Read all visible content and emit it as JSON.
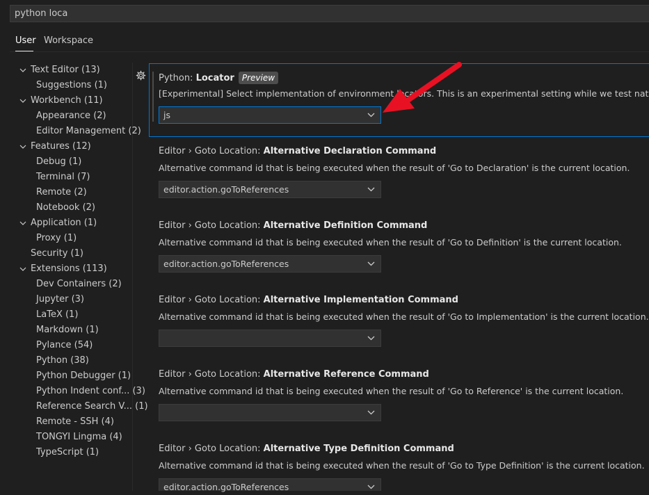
{
  "search": {
    "value": "python loca"
  },
  "tabs": [
    {
      "label": "User"
    },
    {
      "label": "Workspace"
    }
  ],
  "tree": [
    {
      "label": "Text Editor (13)"
    },
    {
      "label": "Suggestions (1)"
    },
    {
      "label": "Workbench (11)"
    },
    {
      "label": "Appearance (2)"
    },
    {
      "label": "Editor Management (2)"
    },
    {
      "label": "Features (12)"
    },
    {
      "label": "Debug (1)"
    },
    {
      "label": "Terminal (7)"
    },
    {
      "label": "Remote (2)"
    },
    {
      "label": "Notebook (2)"
    },
    {
      "label": "Application (1)"
    },
    {
      "label": "Proxy (1)"
    },
    {
      "label": "Security (1)"
    },
    {
      "label": "Extensions (113)"
    },
    {
      "label": "Dev Containers (2)"
    },
    {
      "label": "Jupyter (3)"
    },
    {
      "label": "LaTeX (1)"
    },
    {
      "label": "Markdown (1)"
    },
    {
      "label": "Pylance (54)"
    },
    {
      "label": "Python (38)"
    },
    {
      "label": "Python Debugger (1)"
    },
    {
      "label": "Python Indent conf... (3)"
    },
    {
      "label": "Reference Search V... (1)"
    },
    {
      "label": "Remote - SSH (4)"
    },
    {
      "label": "TONGYI Lingma (4)"
    },
    {
      "label": "TypeScript (1)"
    }
  ],
  "settings": [
    {
      "category": "Python: ",
      "name": "Locator",
      "badge": "Preview",
      "description": "[Experimental] Select implementation of environment locators. This is an experimental setting while we test native environment location.",
      "value": "js"
    },
    {
      "category": "Editor › Goto Location: ",
      "name": "Alternative Declaration Command",
      "description": "Alternative command id that is being executed when the result of 'Go to Declaration' is the current location.",
      "value": "editor.action.goToReferences"
    },
    {
      "category": "Editor › Goto Location: ",
      "name": "Alternative Definition Command",
      "description": "Alternative command id that is being executed when the result of 'Go to Definition' is the current location.",
      "value": "editor.action.goToReferences"
    },
    {
      "category": "Editor › Goto Location: ",
      "name": "Alternative Implementation Command",
      "description": "Alternative command id that is being executed when the result of 'Go to Implementation' is the current location.",
      "value": ""
    },
    {
      "category": "Editor › Goto Location: ",
      "name": "Alternative Reference Command",
      "description": "Alternative command id that is being executed when the result of 'Go to Reference' is the current location.",
      "value": ""
    },
    {
      "category": "Editor › Goto Location: ",
      "name": "Alternative Type Definition Command",
      "description": "Alternative command id that is being executed when the result of 'Go to Type Definition' is the current location.",
      "value": "editor.action.goToReferences"
    }
  ],
  "colors": {
    "focus_border": "#0078d4",
    "annotation_arrow": "#e81123"
  },
  "icons": {
    "gear": "gear-icon",
    "chevron": "chevron-down-icon",
    "annotation": "red-arrow-annotation"
  }
}
